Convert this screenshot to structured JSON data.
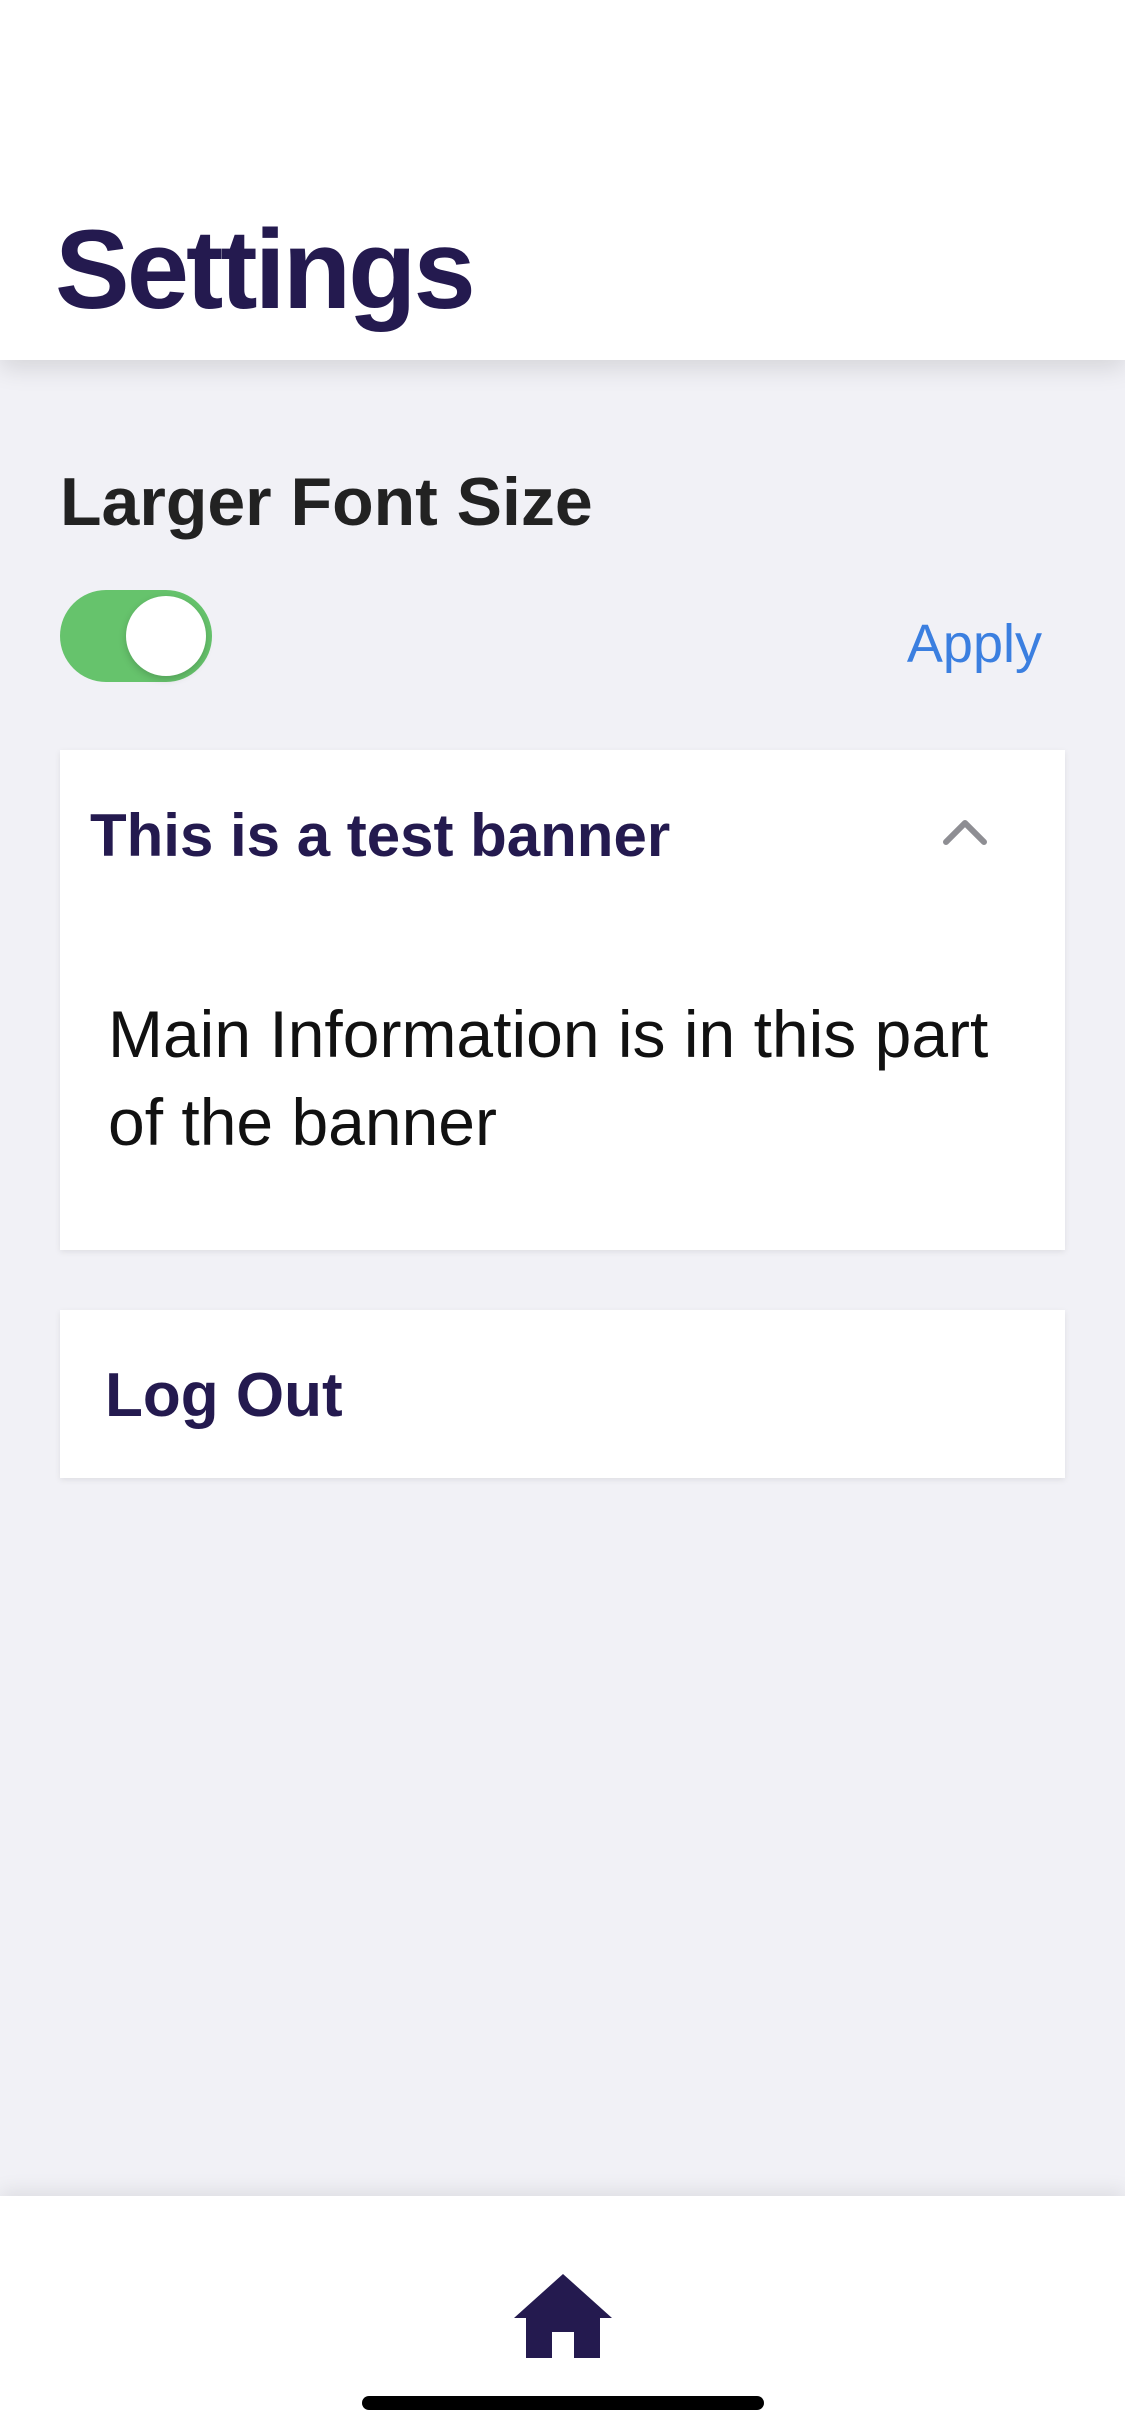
{
  "header": {
    "title": "Settings"
  },
  "preferences": {
    "larger_font_label": "Larger Font Size",
    "larger_font_enabled": true,
    "apply_label": "Apply"
  },
  "banner": {
    "title": "This is a test banner",
    "expanded": true,
    "body": "Main Information is in this part of the banner"
  },
  "logout": {
    "label": "Log Out"
  },
  "tabbar": {
    "items": [
      {
        "icon": "home-icon",
        "selected": true
      }
    ]
  },
  "colors": {
    "brand_text": "#241a4f",
    "toggle_on": "#66c36c",
    "link": "#3b7fe0",
    "background": "#f1f1f6"
  }
}
